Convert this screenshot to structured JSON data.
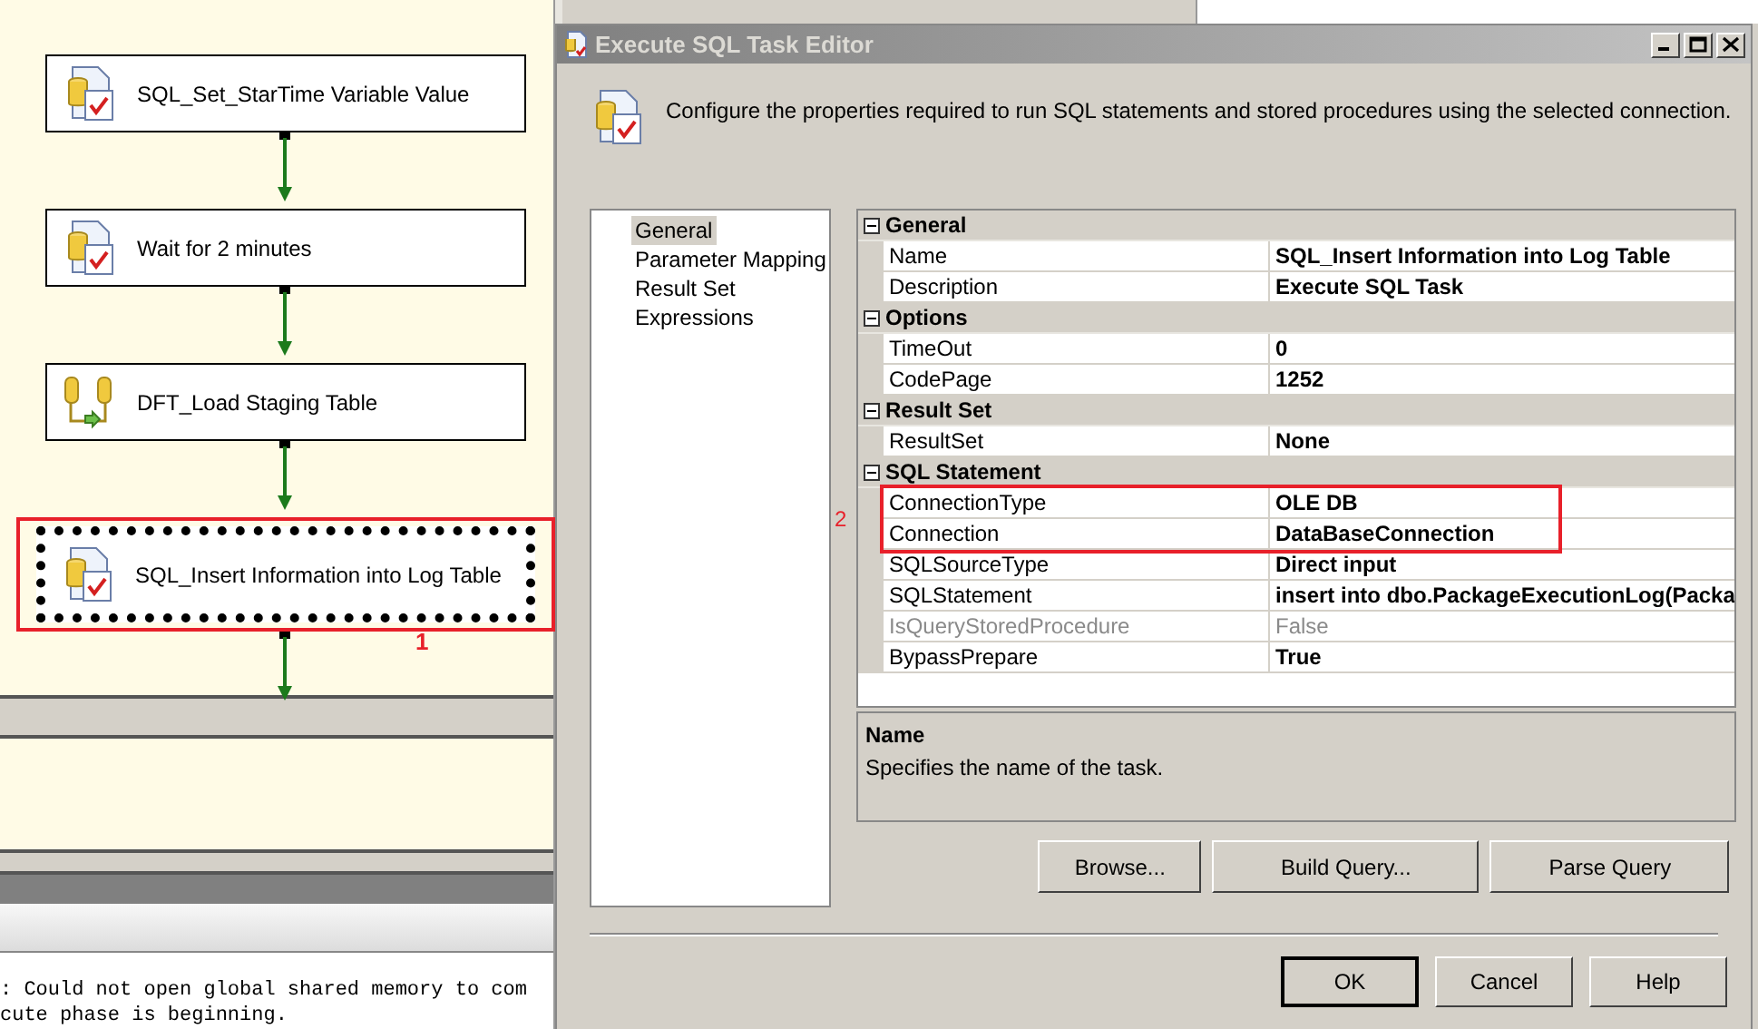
{
  "designer": {
    "tasks": [
      {
        "kind": "sql",
        "label": "SQL_Set_StarTime Variable Value",
        "selected": false,
        "annotated": false
      },
      {
        "kind": "sql",
        "label": "Wait for 2 minutes",
        "selected": false,
        "annotated": false
      },
      {
        "kind": "dataflow",
        "label": "DFT_Load Staging Table",
        "selected": false,
        "annotated": false
      },
      {
        "kind": "sql",
        "label": "SQL_Insert Information into Log Table",
        "selected": true,
        "annotated": true
      }
    ],
    "annotation": "1"
  },
  "output": {
    "lines": [
      ": Could not open global shared memory to com",
      "cute phase is beginning."
    ]
  },
  "dialog": {
    "title": "Execute SQL Task Editor",
    "description": "Configure the properties required to run SQL statements and stored procedures using the selected connection.",
    "nav": [
      {
        "label": "General",
        "selected": true
      },
      {
        "label": "Parameter Mapping",
        "selected": false
      },
      {
        "label": "Result Set",
        "selected": false
      },
      {
        "label": "Expressions",
        "selected": false
      }
    ],
    "grid": {
      "sections": [
        {
          "title": "General",
          "expanded": true,
          "rows": [
            {
              "name": "Name",
              "value": "SQL_Insert Information into Log Table",
              "disabled": false,
              "annotated": false
            },
            {
              "name": "Description",
              "value": "Execute SQL Task",
              "disabled": false,
              "annotated": false
            }
          ]
        },
        {
          "title": "Options",
          "expanded": true,
          "rows": [
            {
              "name": "TimeOut",
              "value": "0",
              "disabled": false,
              "annotated": false
            },
            {
              "name": "CodePage",
              "value": "1252",
              "disabled": false,
              "annotated": false
            }
          ]
        },
        {
          "title": "Result Set",
          "expanded": true,
          "rows": [
            {
              "name": "ResultSet",
              "value": "None",
              "disabled": false,
              "annotated": false
            }
          ]
        },
        {
          "title": "SQL Statement",
          "expanded": true,
          "rows": [
            {
              "name": "ConnectionType",
              "value": "OLE DB",
              "disabled": false,
              "annotated": true
            },
            {
              "name": "Connection",
              "value": "DataBaseConnection",
              "disabled": false,
              "annotated": true
            },
            {
              "name": "SQLSourceType",
              "value": "Direct input",
              "disabled": false,
              "annotated": false
            },
            {
              "name": "SQLStatement",
              "value": "insert into dbo.PackageExecutionLog(Packa",
              "disabled": false,
              "annotated": false
            },
            {
              "name": "IsQueryStoredProcedure",
              "value": "False",
              "disabled": true,
              "annotated": false
            },
            {
              "name": "BypassPrepare",
              "value": "True",
              "disabled": false,
              "annotated": false
            }
          ]
        }
      ],
      "annotation": "2"
    },
    "help": {
      "title": "Name",
      "text": "Specifies the name of the task."
    },
    "action_buttons": [
      "Browse...",
      "Build Query...",
      "Parse Query"
    ],
    "buttons": [
      {
        "label": "OK",
        "default": true
      },
      {
        "label": "Cancel",
        "default": false
      },
      {
        "label": "Help",
        "default": false
      }
    ]
  }
}
